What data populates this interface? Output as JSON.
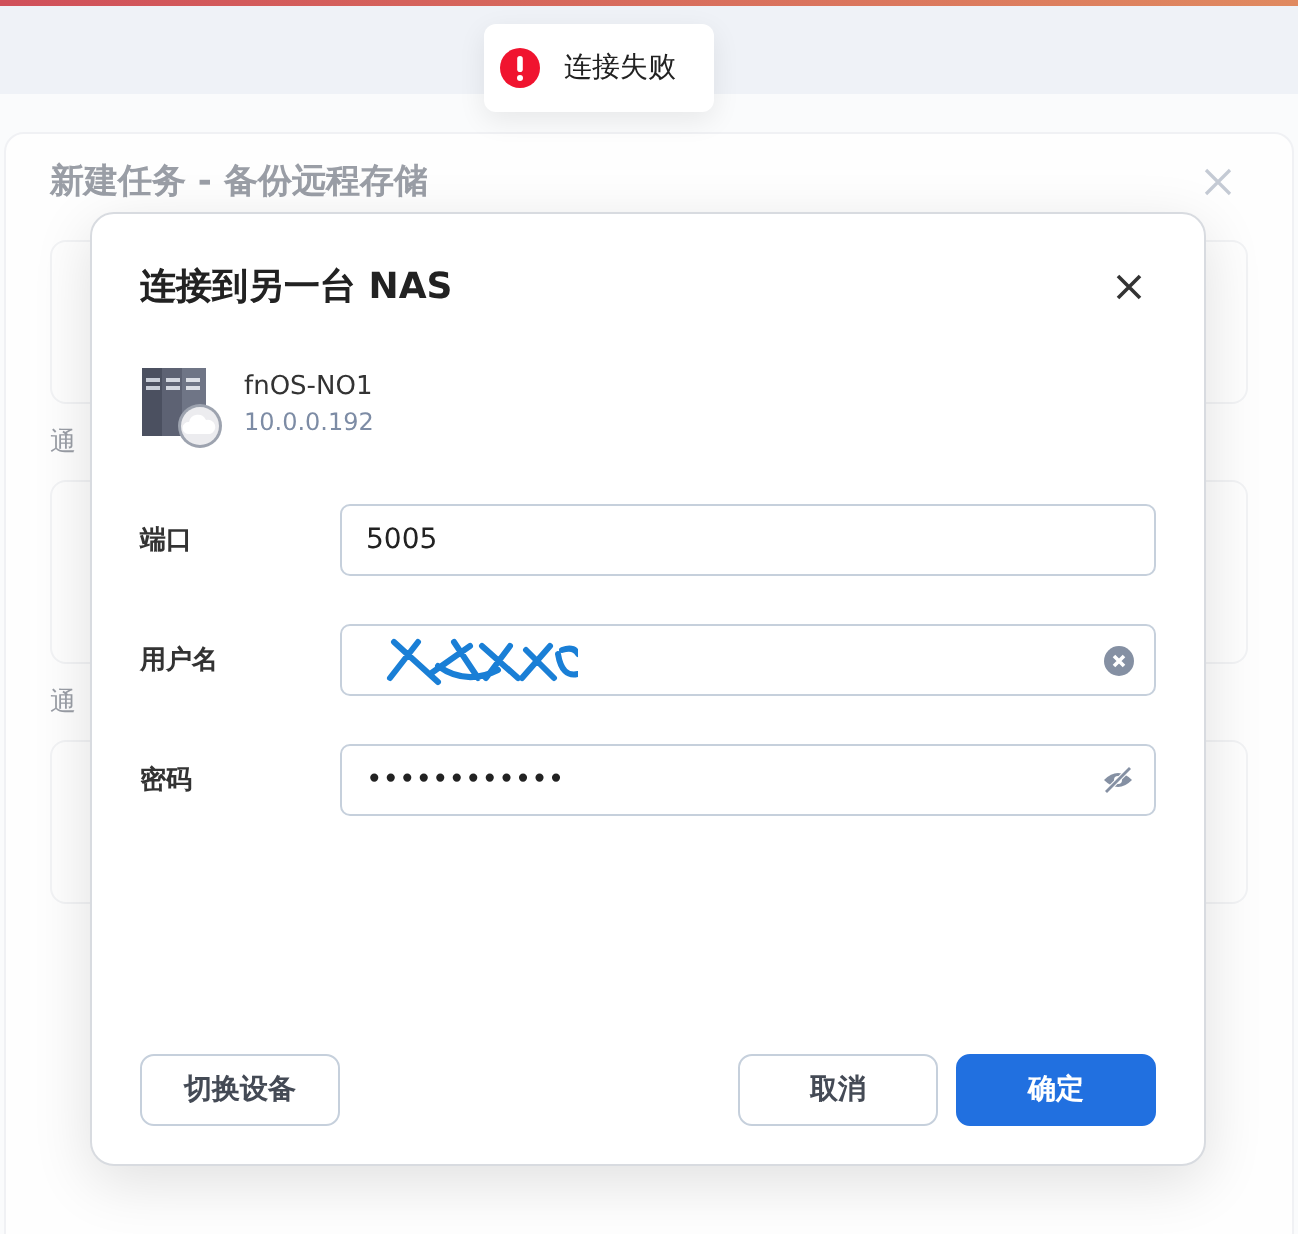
{
  "background_page": {
    "title": "新建任务 - 备份远程存储",
    "section_labels": [
      "通",
      "通"
    ]
  },
  "toast": {
    "kind": "error",
    "message": "连接失败"
  },
  "dialog": {
    "title": "连接到另一台 NAS",
    "device": {
      "name": "fnOS-NO1",
      "address": "10.0.0.192"
    },
    "fields": [
      {
        "label": "端口",
        "kind": "text",
        "value": "5005"
      },
      {
        "label": "用户名",
        "kind": "redacted"
      },
      {
        "label": "密码",
        "kind": "password",
        "value": "••••••••••••"
      }
    ],
    "buttons": [
      {
        "label": "切换设备",
        "kind": "secondary"
      },
      {
        "label": "取消",
        "kind": "secondary"
      },
      {
        "label": "确定",
        "kind": "primary"
      }
    ]
  }
}
